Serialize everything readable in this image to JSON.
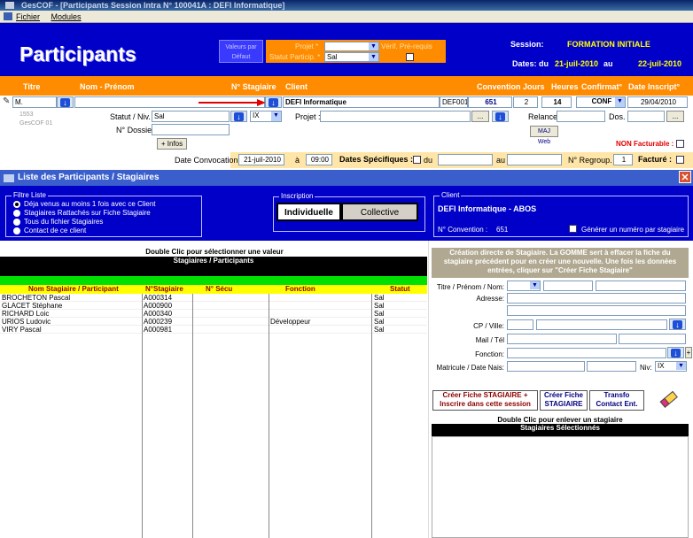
{
  "window": {
    "title": "GesCOF - [Participants Session Intra N° 100041A : DEFI Informatique]"
  },
  "menu": {
    "items": [
      "Fichier",
      "Modules"
    ]
  },
  "header": {
    "title": "Participants",
    "default_btn": "Valeurs par Défaut",
    "projet_label": "Projet *",
    "statut_label": "Statut Particip. *",
    "statut_value": "Sal",
    "verif_label": "Vérif. Pré-requis",
    "session_label": "Session:",
    "session_value": "FORMATION INITIALE",
    "dates_label": "Dates: du",
    "date_from": "21-juil-2010",
    "au": "au",
    "date_to": "22-juil-2010"
  },
  "columns": {
    "titre": "Titre",
    "nom": "Nom - Prénom",
    "stagiaire": "N° Stagiaire",
    "client": "Client",
    "convention": "Convention",
    "jours": "Jours",
    "heures": "Heures",
    "confirmat": "Confirmat°",
    "date_inscript": "Date Inscript°"
  },
  "record": {
    "titre": "M.",
    "client": "DEFI Informatique",
    "client_code": "DEF001",
    "convention": "651",
    "jours": "2",
    "heures": "14",
    "confirmat": "CONF",
    "date_inscript": "29/04/2010",
    "id_small": "1553",
    "gescof": "GesCOF 01",
    "statut_niv_label": "Statut / Niv. :",
    "statut_value": "Sal",
    "niv_value": "IX",
    "projet_label": "Projet :",
    "dossier_label": "N° Dossier :",
    "relance_label": "Relance",
    "dos_label": "Dos. :",
    "maj_web": "MAJ Web",
    "infos_btn": "+ Infos",
    "non_facturable": "NON Facturable :",
    "date_convoc_label": "Date Convocation :",
    "date_convoc": "21-juil-2010",
    "a_label": "à",
    "heure": "09:00",
    "dates_spec_label": "Dates Spécifiques :",
    "du_label": "du",
    "au_label": "au",
    "regroup_label": "N° Regroup. :",
    "regroup_value": "1",
    "facture_label": "Facturé :"
  },
  "panel": {
    "title": "Liste des Participants / Stagiaires",
    "filtre_title": "Filtre Liste",
    "filtres": [
      "Déja venus au moins 1 fois avec ce Client",
      "Stagiaires Rattachés sur Fiche Stagiaire",
      "Tous du fichier Stagiaires",
      "Contact de ce client"
    ],
    "inscription_title": "Inscription",
    "individuelle": "Individuelle",
    "collective": "Collective",
    "client_title": "Client",
    "client_name": "DEFI Informatique - ABOS",
    "convention_label": "N° Convention :",
    "convention_value": "651",
    "generer_label": "Générer un numéro par stagiaire"
  },
  "list": {
    "hint": "Double Clic pour sélectionner une valeur",
    "heading": "Stagiaires / Participants",
    "headers": [
      "Nom Stagiaire / Participant",
      "N°Stagiaire",
      "N° Sécu",
      "Fonction",
      "Statut"
    ],
    "rows": [
      [
        "BROCHETON Pascal",
        "A000314",
        "",
        "",
        "Sal"
      ],
      [
        "GLACET Stéphane",
        "A000900",
        "",
        "",
        "Sal"
      ],
      [
        "RICHARD Loic",
        "A000340",
        "",
        "",
        "Sal"
      ],
      [
        "URIOS Ludovic",
        "A000239",
        "",
        "Développeur",
        "Sal"
      ],
      [
        "VIRY Pascal",
        "A000981",
        "",
        "",
        "Sal"
      ]
    ]
  },
  "stagiaire_form": {
    "instructions": "Création directe de Stagiaire. La GOMME sert à effacer la fiche du stagiaire précédent pour en créer une nouvelle. Une fois les données entrées, cliquer sur \"Créer Fiche Stagiaire\"",
    "titre_label": "Titre / Prénom / Nom:",
    "adresse_label": "Adresse:",
    "cp_label": "CP / Ville:",
    "mail_label": "Mail / Tél",
    "fonction_label": "Fonction:",
    "matricule_label": "Matricule / Date Nais:",
    "niv_label": "Niv:",
    "niv_value": "IX",
    "btn_creer_inscrire": "Créer Fiche STAGIAIRE + Inscrire dans cette session",
    "btn_creer": "Créer Fiche STAGIAIRE",
    "btn_transfo": "Transfo Contact Ent.",
    "remove_hint": "Double Clic pour enlever un stagiaire",
    "selected_heading": "Stagiaires Sélectionnés"
  }
}
